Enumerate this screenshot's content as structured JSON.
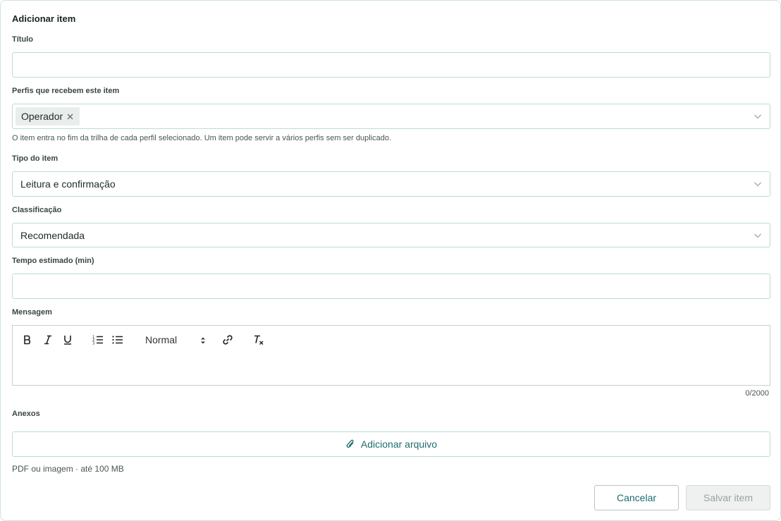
{
  "dialog": {
    "title": "Adicionar item"
  },
  "fields": {
    "titulo": {
      "label": "Título",
      "value": "",
      "placeholder": ""
    },
    "perfis": {
      "label": "Perfis que recebem este item",
      "chips": [
        "Operador"
      ],
      "help": "O item entra no fim da trilha de cada perfil selecionado. Um item pode servir a vários perfis sem ser duplicado."
    },
    "tipo": {
      "label": "Tipo do item",
      "value": "Leitura e confirmação"
    },
    "classificacao": {
      "label": "Classificação",
      "value": "Recomendada"
    },
    "tempo": {
      "label": "Tempo estimado (min)",
      "value": "",
      "placeholder": ""
    },
    "mensagem": {
      "label": "Mensagem",
      "toolbar": {
        "bold_icon": "bold-icon",
        "italic_icon": "italic-icon",
        "underline_icon": "underline-icon",
        "ordered_list_icon": "ordered-list-icon",
        "bullet_list_icon": "bullet-list-icon",
        "heading_value": "Normal",
        "link_icon": "link-icon",
        "clear_format_icon": "clear-format-icon"
      },
      "counter": "0/2000"
    },
    "anexos": {
      "label": "Anexos",
      "button_label": "Adicionar arquivo",
      "hint": "PDF ou imagem · até 100 MB"
    }
  },
  "actions": {
    "cancel_label": "Cancelar",
    "save_label": "Salvar item"
  },
  "colors": {
    "accent": "#1c6e6a",
    "border": "#b9dcd6",
    "disabled_text": "#9aa3a2"
  }
}
